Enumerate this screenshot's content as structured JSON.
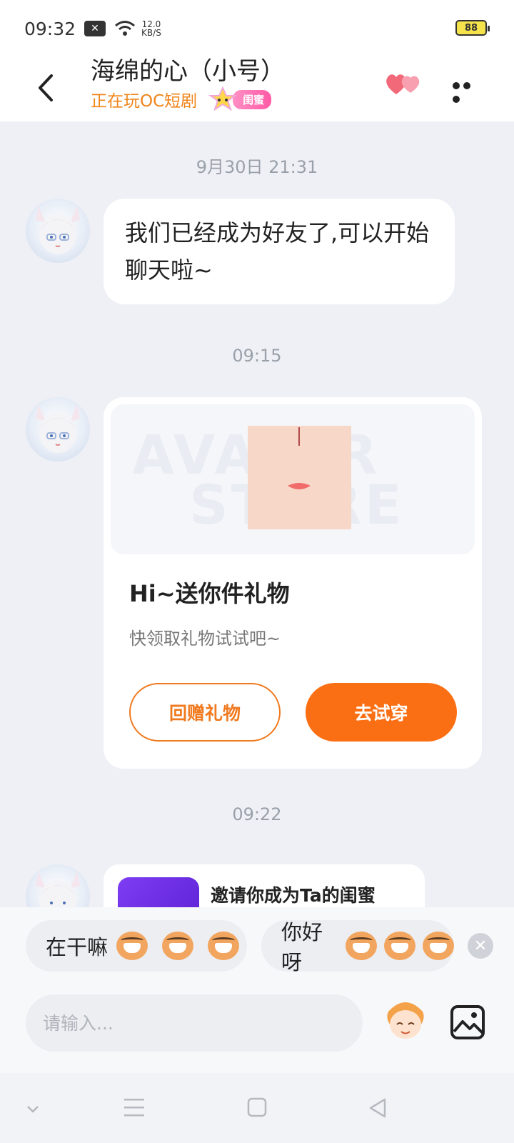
{
  "status_bar": {
    "time": "09:32",
    "net_speed_value": "12.0",
    "net_speed_unit": "KB/S",
    "battery": "88"
  },
  "header": {
    "title": "海绵的心（小号）",
    "subtitle": "正在玩OC短剧",
    "badge_label": "闺蜜"
  },
  "chat": {
    "messages": [
      {
        "timestamp": "9月30日 21:31",
        "text": "我们已经成为好友了,可以开始聊天啦~"
      },
      {
        "timestamp": "09:15",
        "gift": {
          "watermark_line1": "AVATAR",
          "watermark_line2": "STORE",
          "title": "Hi~送你件礼物",
          "subtitle": "快领取礼物试试吧~",
          "return_button": "回赠礼物",
          "try_button": "去试穿"
        }
      },
      {
        "timestamp": "09:22",
        "invite": {
          "title": "邀请你成为Ta的闺蜜"
        }
      }
    ]
  },
  "quick_replies": [
    {
      "text": "在干嘛"
    },
    {
      "text": "你好呀"
    }
  ],
  "input": {
    "placeholder": "请输入..."
  },
  "colors": {
    "accent_orange": "#fb6f14",
    "subtitle_orange": "#f08419",
    "badge_pink": "#ff5aa7",
    "background": "#eef0f5"
  }
}
